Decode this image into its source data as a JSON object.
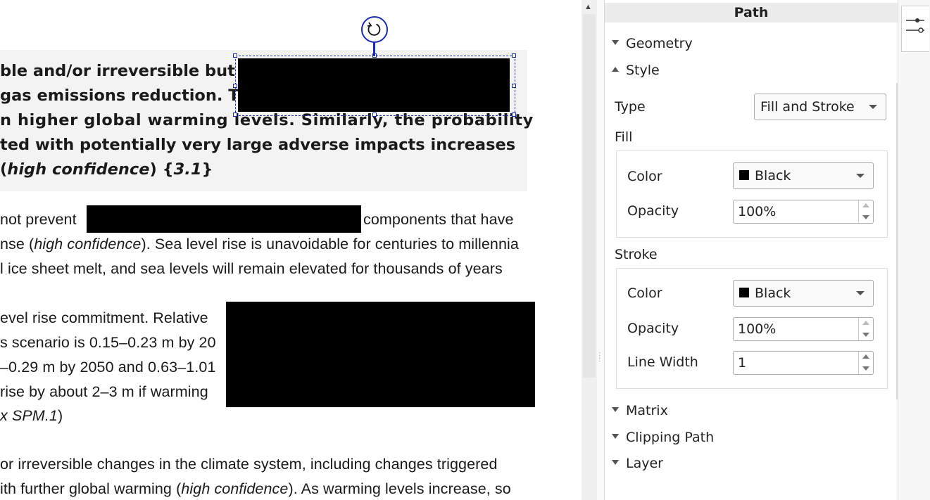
{
  "document": {
    "summary_lines": [
      "ble and/or irreversible but",
      "gas emissions reduction. T",
      "n higher global warming levels. Similarly, the probability",
      "ted with potentially very large adverse impacts increases"
    ],
    "summary_last": {
      "pre": "(",
      "italic": "high confidence",
      "mid": ") {",
      "italic2": "3.1",
      "post": "}"
    },
    "para1": {
      "line1_left": "not prevent",
      "line1_right": "components that have",
      "line2_pre": "nse (",
      "line2_italic": "high confidence",
      "line2_post": "). Sea level rise is unavoidable for centuries to millennia",
      "line3": "l ice sheet melt, and sea levels will remain elevated for thousands of years"
    },
    "para2": {
      "lines": [
        "evel rise commitment. Relative",
        "s scenario is 0.15–0.23 m by 20",
        "–0.29 m by 2050 and 0.63–1.01",
        "rise by about 2–3 m if warming"
      ],
      "last_italic": "x SPM.1",
      "last_post": ")"
    },
    "para3": {
      "line1": "or irreversible changes in the climate system, including changes triggered",
      "line2_pre": "ith further global warming (",
      "line2_italic": "high confidence",
      "line2_post": "). As warming levels increase, so"
    }
  },
  "panel": {
    "title": "Path",
    "sections": {
      "geometry": "Geometry",
      "style": "Style",
      "matrix": "Matrix",
      "clipping": "Clipping Path",
      "layer": "Layer"
    },
    "type_label": "Type",
    "type_value": "Fill and Stroke",
    "fill": {
      "heading": "Fill",
      "color_label": "Color",
      "color_value": "Black",
      "opacity_label": "Opacity",
      "opacity_value": "100%"
    },
    "stroke": {
      "heading": "Stroke",
      "color_label": "Color",
      "color_value": "Black",
      "opacity_label": "Opacity",
      "opacity_value": "100%",
      "width_label": "Line Width",
      "width_value": "1"
    }
  },
  "colors": {
    "selection": "#1a2bb3",
    "summary_bg": "#f3f3f3",
    "redaction": "#000000"
  }
}
